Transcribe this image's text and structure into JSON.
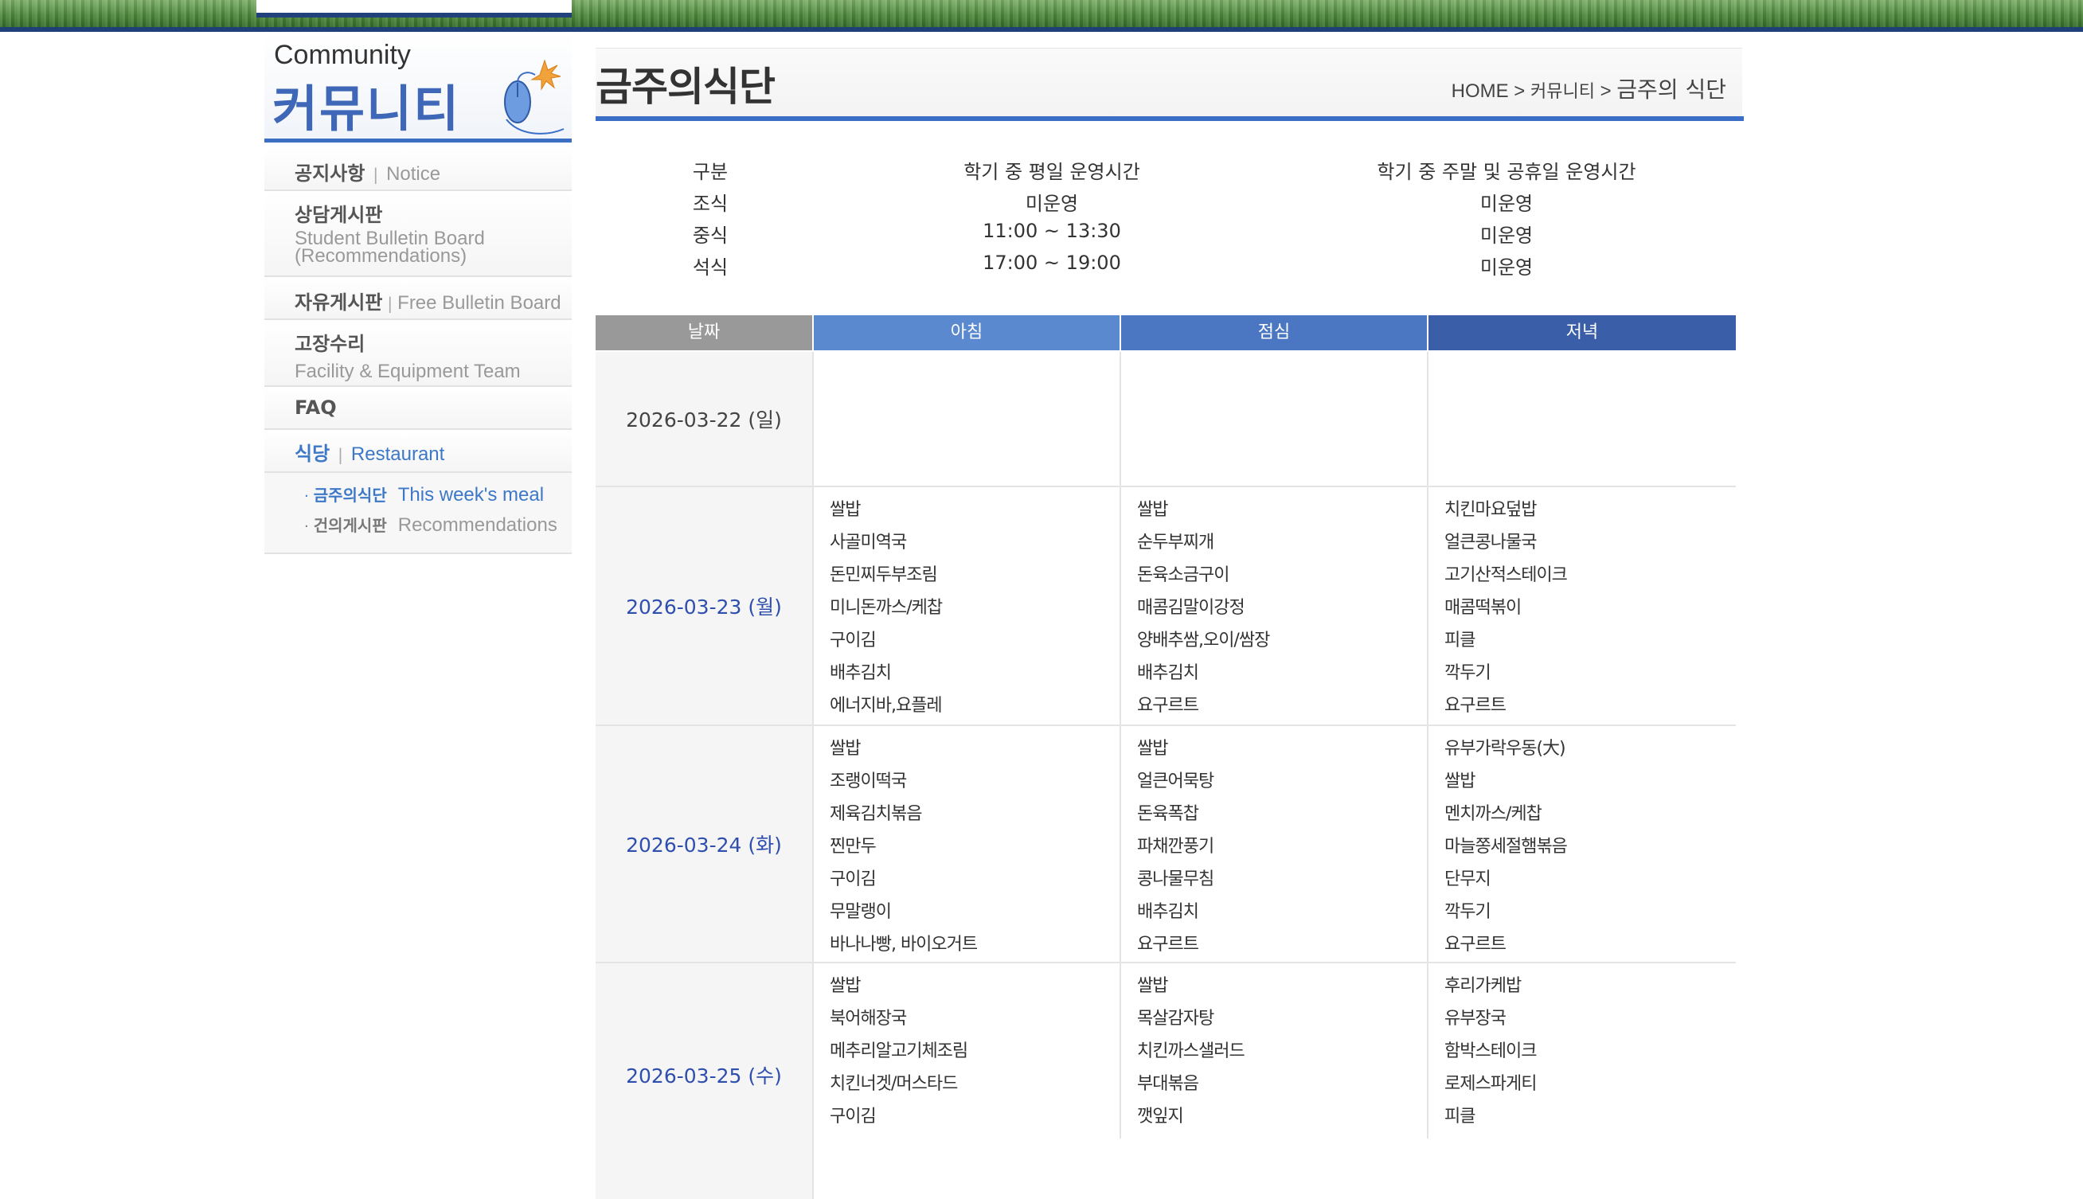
{
  "sidebar": {
    "eyebrow": "Community",
    "title": "커뮤니티",
    "menu": [
      {
        "ko": "공지사항",
        "sep": "|",
        "en": "Notice"
      },
      {
        "ko": "상담게시판",
        "en_line1": "Student Bulletin Board",
        "en_line2": "(Recommendations)"
      },
      {
        "ko": "자유게시판",
        "sep": "|",
        "en": "Free Bulletin Board"
      },
      {
        "ko": "고장수리",
        "en": "Facility & Equipment Team"
      },
      {
        "ko": "FAQ"
      },
      {
        "ko": "식당",
        "sep": "|",
        "en": "Restaurant"
      }
    ],
    "submenu": [
      {
        "bullet": "·",
        "ko": "금주의식단",
        "en": "This week's meal"
      },
      {
        "bullet": "·",
        "ko": "건의게시판",
        "en": "Recommendations"
      }
    ]
  },
  "page": {
    "title": "금주의식단",
    "breadcrumb": {
      "home": "HOME",
      "sep1": " > ",
      "mid": "커뮤니티",
      "sep2": " > ",
      "current": "금주의 식단"
    }
  },
  "hours": {
    "headers": [
      "구분",
      "학기 중 평일 운영시간",
      "학기 중 주말 및 공휴일 운영시간"
    ],
    "rows": [
      [
        "조식",
        "미운영",
        "미운영"
      ],
      [
        "중식",
        "11:00 ~ 13:30",
        "미운영"
      ],
      [
        "석식",
        "17:00 ~ 19:00",
        "미운영"
      ]
    ]
  },
  "menu_table": {
    "headers": [
      "날짜",
      "아침",
      "점심",
      "저녁"
    ],
    "header_colors": [
      "#999999",
      "#5b89cf",
      "#4a76c2",
      "#3a5fa8"
    ],
    "rows": [
      {
        "date": "2026-03-22 (일)",
        "breakfast": [],
        "lunch": [],
        "dinner": []
      },
      {
        "date": "2026-03-23 (월)",
        "breakfast": [
          "쌀밥",
          "사골미역국",
          "돈민찌두부조림",
          "미니돈까스/케찹",
          "구이김",
          "배추김치",
          "에너지바,요플레"
        ],
        "lunch": [
          "쌀밥",
          "순두부찌개",
          "돈육소금구이",
          "매콤김말이강정",
          "양배추쌈,오이/쌈장",
          "배추김치",
          "요구르트"
        ],
        "dinner": [
          "치킨마요덮밥",
          "얼큰콩나물국",
          "고기산적스테이크",
          "매콤떡볶이",
          "피클",
          "깍두기",
          "요구르트"
        ]
      },
      {
        "date": "2026-03-24 (화)",
        "breakfast": [
          "쌀밥",
          "조랭이떡국",
          "제육김치볶음",
          "찐만두",
          "구이김",
          "무말랭이",
          "바나나빵, 바이오거트"
        ],
        "lunch": [
          "쌀밥",
          "얼큰어묵탕",
          "돈육폭찹",
          "파채깐풍기",
          "콩나물무침",
          "배추김치",
          "요구르트"
        ],
        "dinner": [
          "유부가락우동(大)",
          "쌀밥",
          "멘치까스/케찹",
          "마늘쫑세절햄볶음",
          "단무지",
          "깍두기",
          "요구르트"
        ]
      },
      {
        "date": "2026-03-25 (수)",
        "breakfast": [
          "쌀밥",
          "북어해장국",
          "메추리알고기체조림",
          "치킨너겟/머스타드",
          "구이김"
        ],
        "lunch": [
          "쌀밥",
          "목살감자탕",
          "치킨까스샐러드",
          "부대볶음",
          "깻잎지"
        ],
        "dinner": [
          "후리가케밥",
          "유부장국",
          "함박스테이크",
          "로제스파게티",
          "피클"
        ]
      }
    ]
  },
  "colors": {
    "accent": "#3b6ec6",
    "date_highlight": "#2f4fae",
    "sidebar_title": "#3f67b8",
    "active_menu": "#3d78c8"
  }
}
